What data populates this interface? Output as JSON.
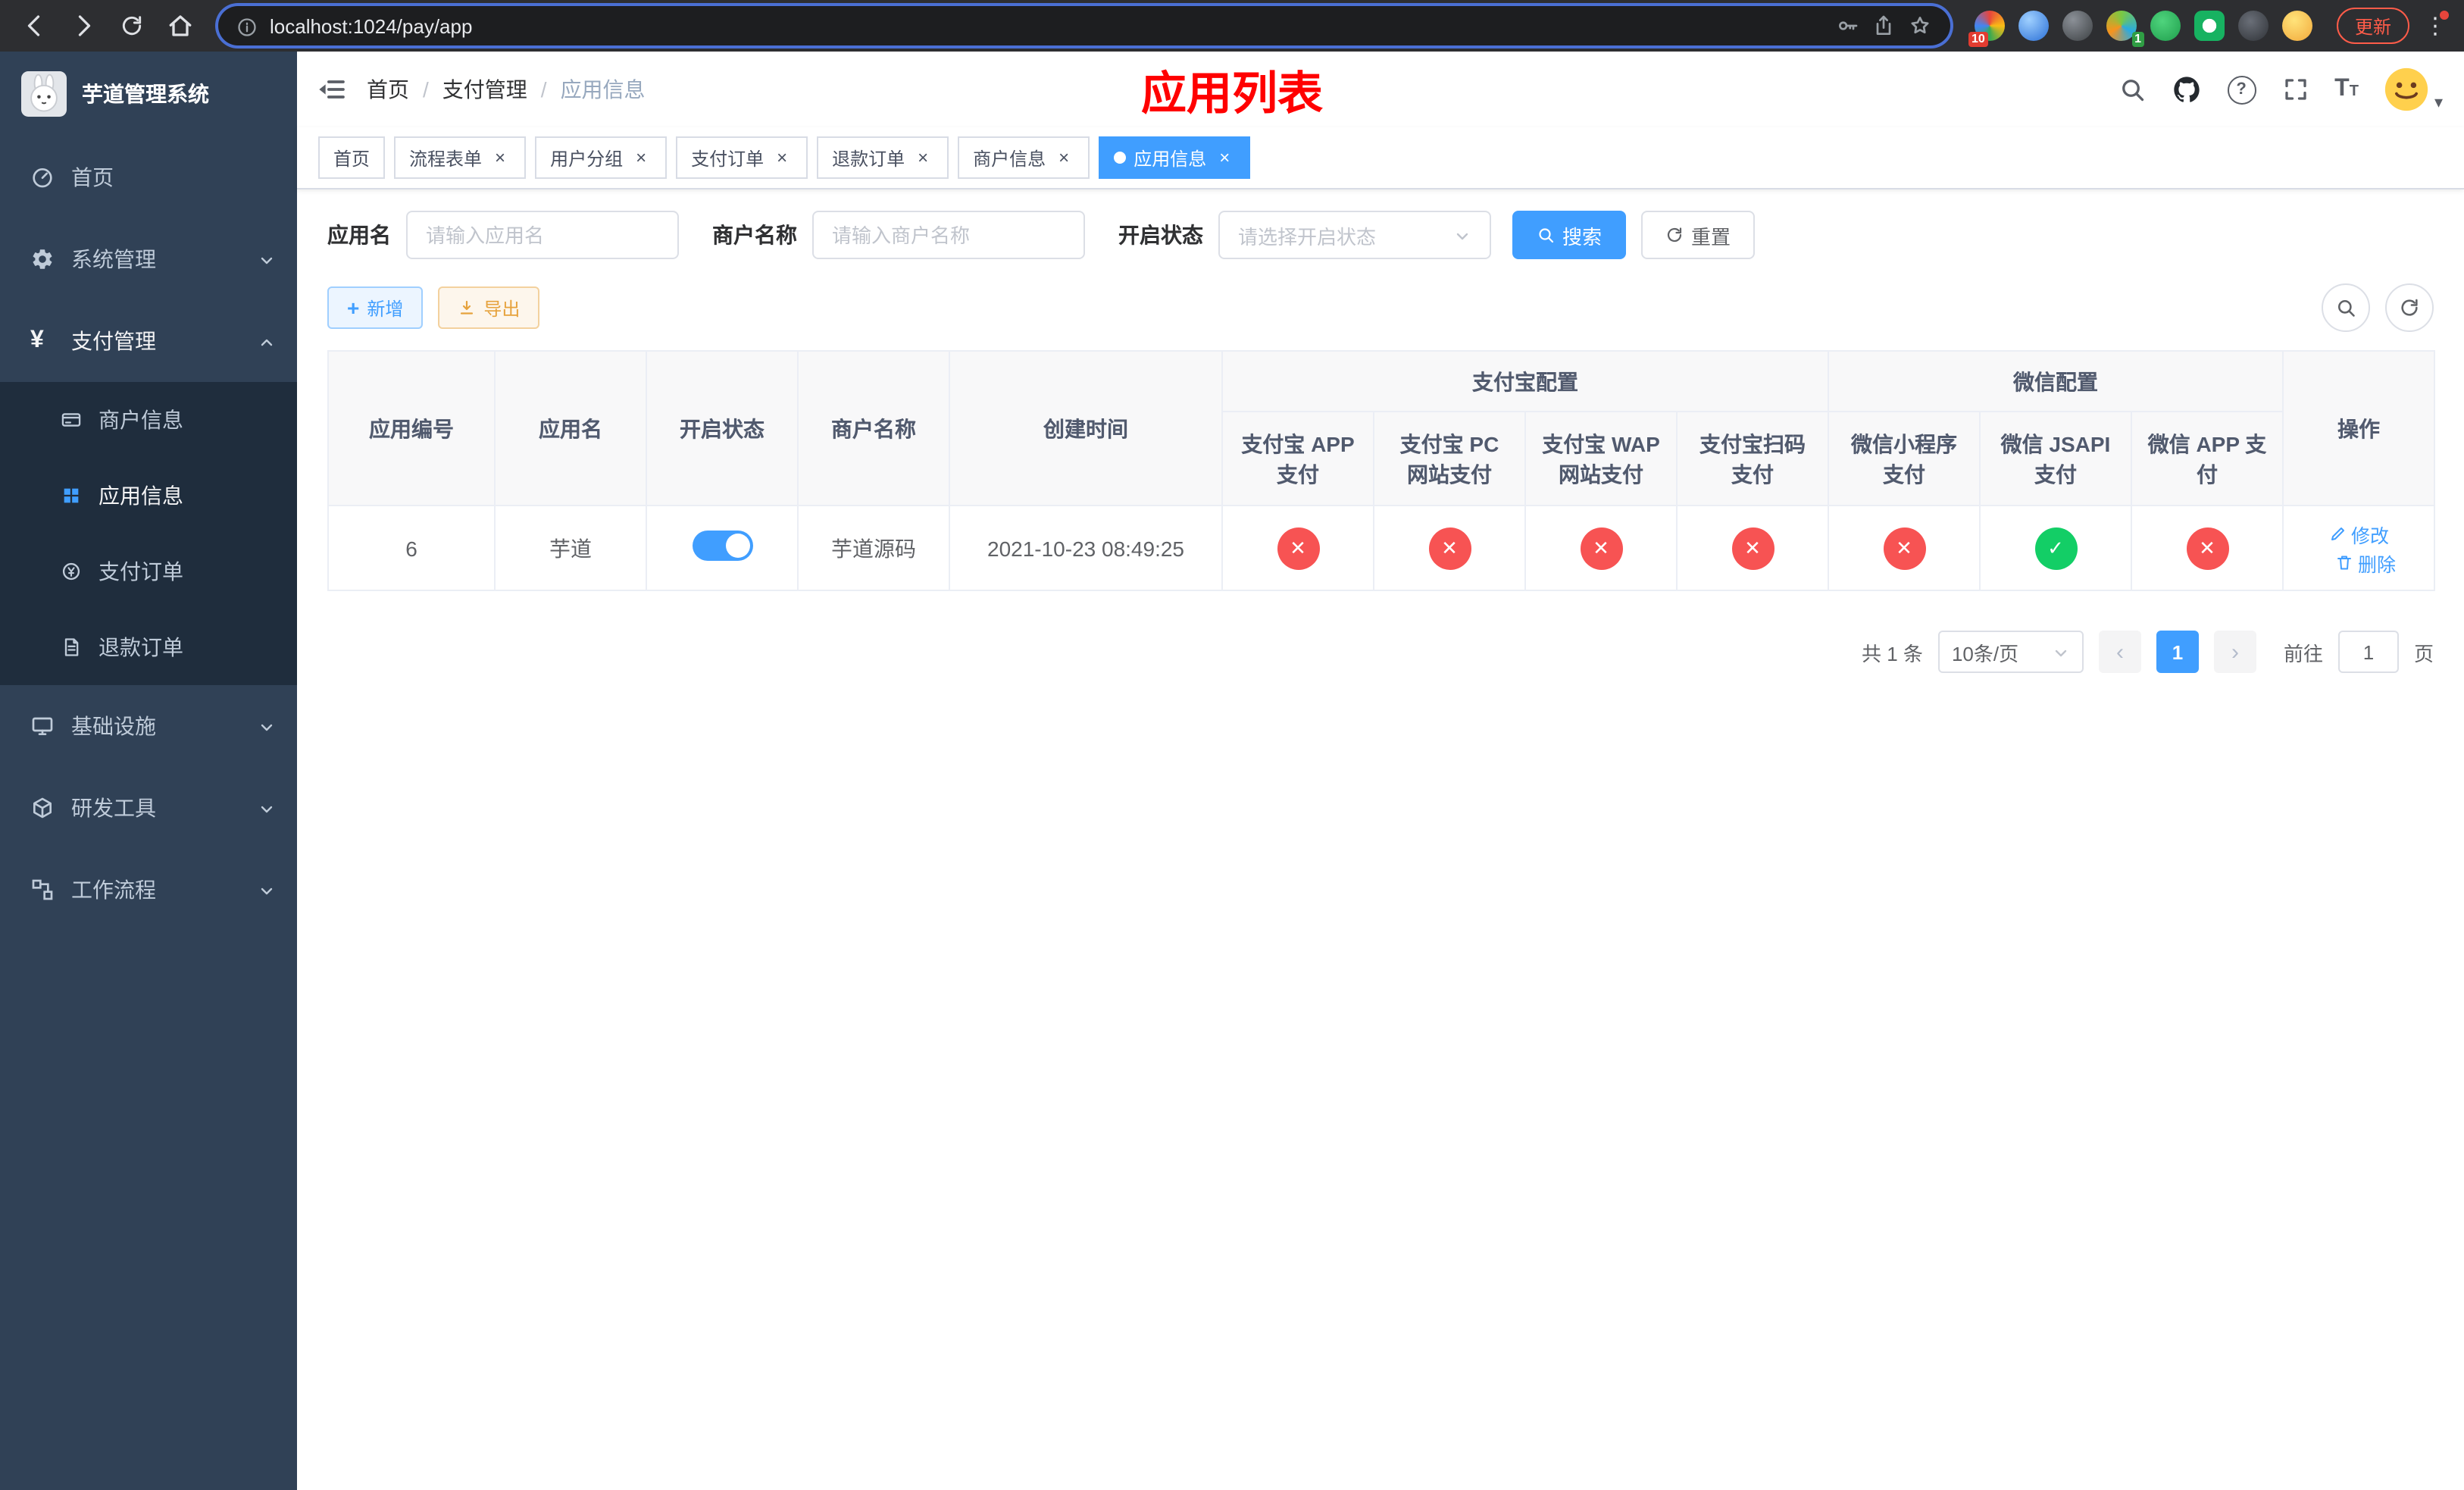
{
  "colors": {
    "primary_blue": "#409eff",
    "banner_red": "#ff0000",
    "status_pass_green": "#13ce66",
    "status_fail_red": "#f75353",
    "sidebar_bg": "#304156",
    "submenu_bg": "#1f2d3d",
    "warning_orange": "#e6a23c"
  },
  "icons": {
    "close": "×",
    "check": "✓",
    "cross": "✕",
    "yen": "¥",
    "plus": "+",
    "prev": "‹",
    "next": "›",
    "question": "?",
    "kebab": "⋮",
    "caret_down": "▾",
    "font_t": "T"
  },
  "browser": {
    "url": "localhost:1024/pay/app",
    "update_label": "更新",
    "ext_badge_red": "10",
    "ext_badge_green": "1"
  },
  "sidebar": {
    "app_title": "芋道管理系统",
    "items": [
      {
        "label": "首页"
      },
      {
        "label": "系统管理"
      },
      {
        "label": "支付管理"
      },
      {
        "label": "基础设施"
      },
      {
        "label": "研发工具"
      },
      {
        "label": "工作流程"
      }
    ],
    "pay_children": [
      {
        "label": "商户信息"
      },
      {
        "label": "应用信息"
      },
      {
        "label": "支付订单"
      },
      {
        "label": "退款订单"
      }
    ]
  },
  "header": {
    "breadcrumb": [
      "首页",
      "支付管理",
      "应用信息"
    ],
    "breadcrumb_sep": "/",
    "banner_title": "应用列表"
  },
  "tabs": [
    {
      "label": "首页"
    },
    {
      "label": "流程表单"
    },
    {
      "label": "用户分组"
    },
    {
      "label": "支付订单"
    },
    {
      "label": "退款订单"
    },
    {
      "label": "商户信息"
    },
    {
      "label": "应用信息"
    }
  ],
  "filters": {
    "app_name_label": "应用名",
    "app_name_placeholder": "请输入应用名",
    "merchant_label": "商户名称",
    "merchant_placeholder": "请输入商户名称",
    "status_label": "开启状态",
    "status_placeholder": "请选择开启状态",
    "search_label": "搜索",
    "reset_label": "重置"
  },
  "toolbar": {
    "add_label": "新增",
    "export_label": "导出"
  },
  "table": {
    "group_alipay": "支付宝配置",
    "group_wechat": "微信配置",
    "col_app_id": "应用编号",
    "col_app_name": "应用名",
    "col_status": "开启状态",
    "col_merchant": "商户名称",
    "col_created": "创建时间",
    "col_alipay_app": "支付宝 APP 支付",
    "col_alipay_pc": "支付宝 PC 网站支付",
    "col_alipay_wap": "支付宝 WAP 网站支付",
    "col_alipay_qr": "支付宝扫码支付",
    "col_wx_lite": "微信小程序支付",
    "col_wx_jsapi": "微信 JSAPI 支付",
    "col_wx_app": "微信 APP 支付",
    "col_ops": "操作",
    "rows": [
      {
        "app_id": "6",
        "app_name": "芋道",
        "enabled": true,
        "merchant_name": "芋道源码",
        "create_time": "2021-10-23 08:49:25",
        "alipay_app": false,
        "alipay_pc": false,
        "alipay_wap": false,
        "alipay_qr": false,
        "wx_lite": false,
        "wx_jsapi": true,
        "wx_app": false,
        "edit_label": "修改",
        "delete_label": "删除"
      }
    ]
  },
  "pagination": {
    "total_text": "共 1 条",
    "page_size_text": "10条/页",
    "page_1": "1",
    "goto_label": "前往",
    "goto_value": "1",
    "unit_label": "页"
  }
}
